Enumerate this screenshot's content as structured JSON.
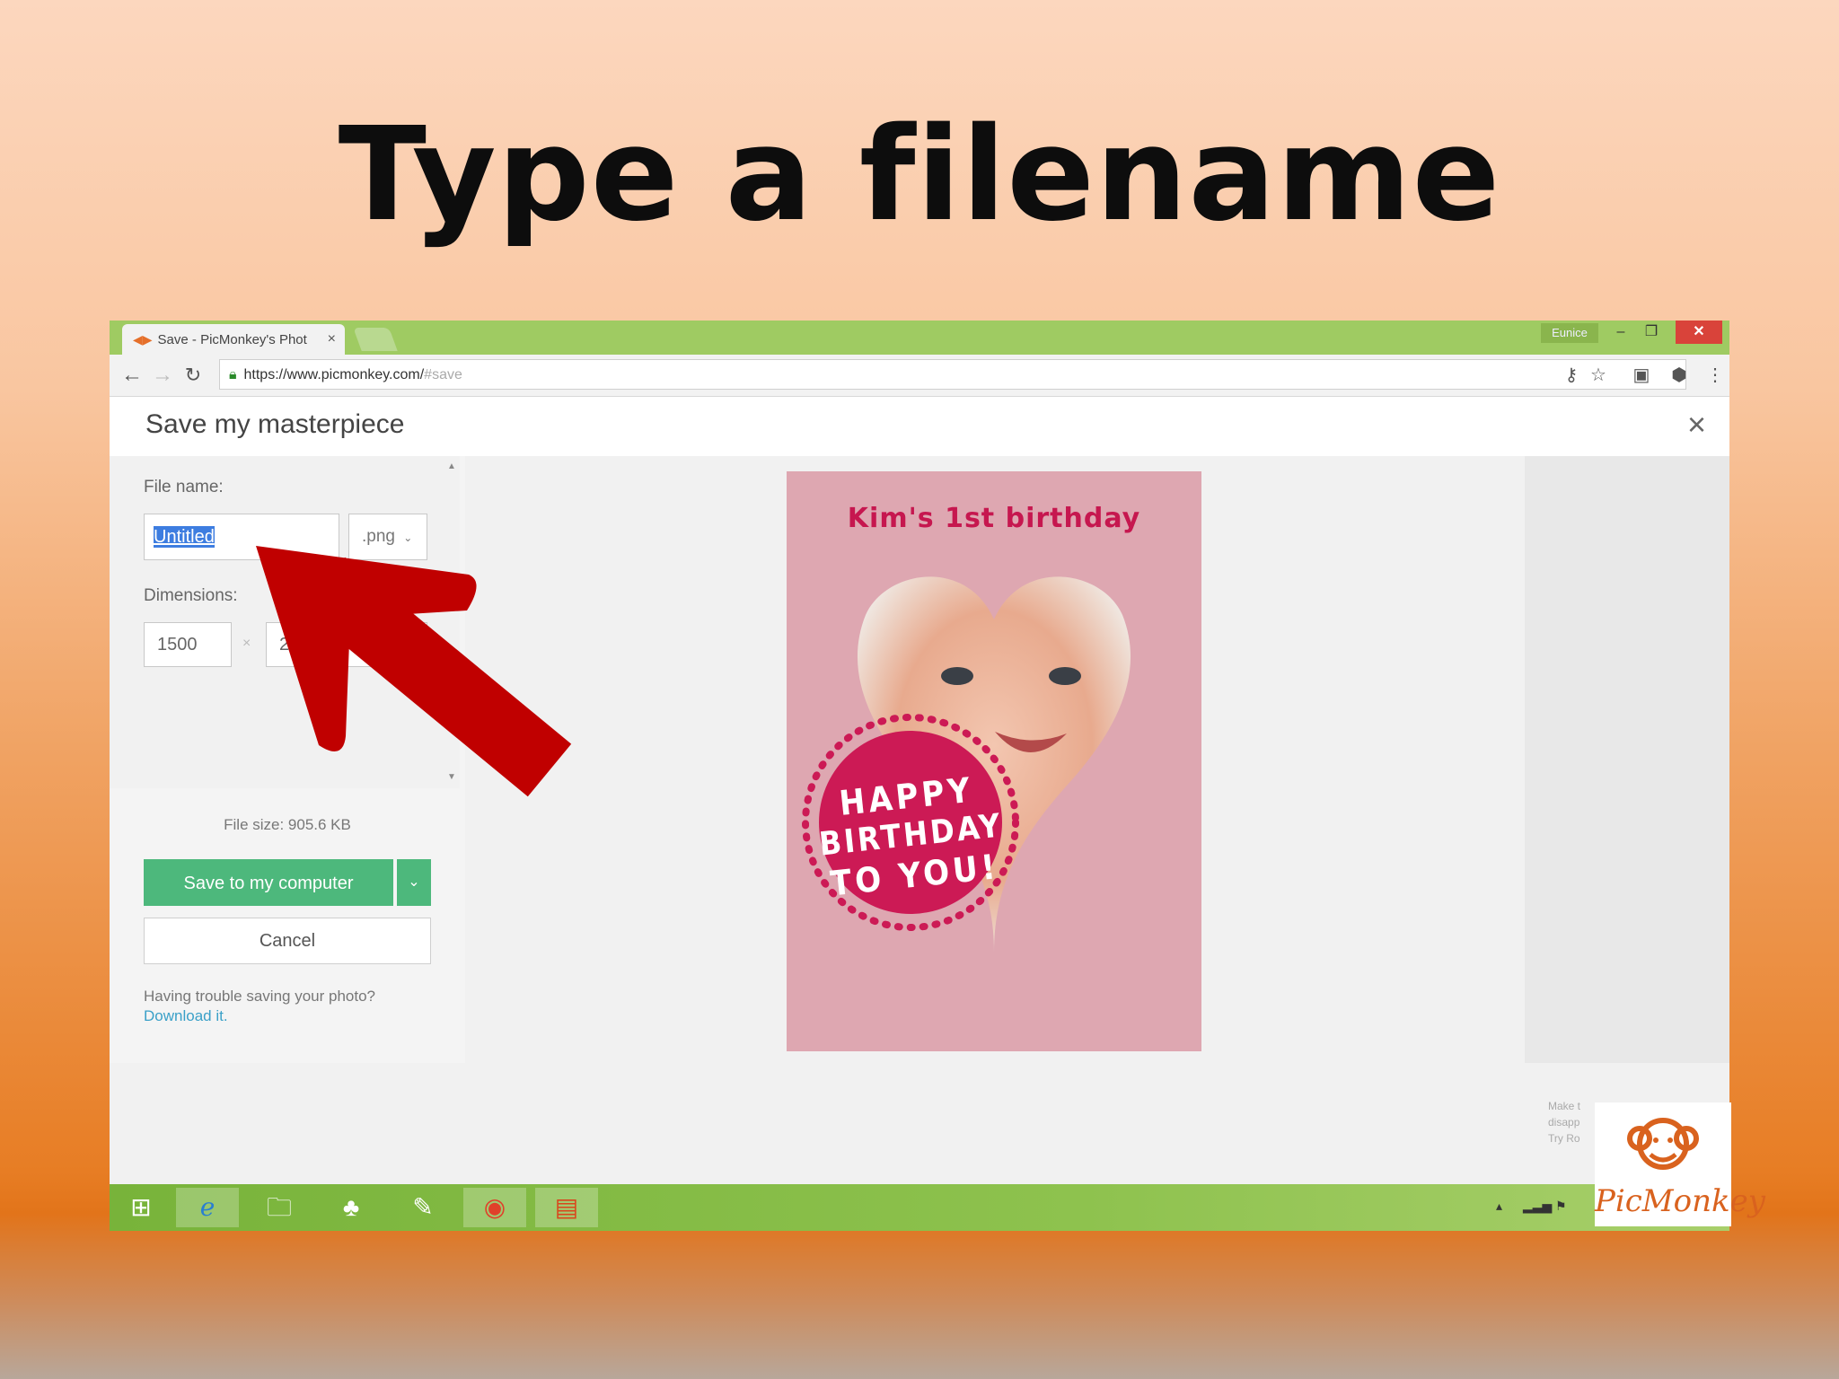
{
  "slide": {
    "title": "Type a filename"
  },
  "browser": {
    "tab_title": "Save - PicMonkey's Phot",
    "tab_close": "×",
    "profile_name": "Eunice",
    "win_min": "–",
    "win_max": "❐",
    "win_close": "✕",
    "url_main": "https://www.picmonkey.com/",
    "url_hash": "#save"
  },
  "dialog": {
    "title": "Save my masterpiece",
    "close": "×",
    "file_name_label": "File name:",
    "file_name_value": "Untitled",
    "file_type": ".png",
    "dimensions_label": "Dimensions:",
    "width_value": "1500",
    "dim_separator": "×",
    "height_value": "2",
    "file_size": "File size: 905.6 KB",
    "save_button": "Save to my computer",
    "cancel_button": "Cancel",
    "trouble_text": "Having trouble saving your photo?",
    "download_link": "Download it."
  },
  "preview": {
    "card_title": "Kim's 1st birthday",
    "badge_lines": [
      "HAPPY",
      "BIRTHDAY",
      "TO YOU!"
    ]
  },
  "side_note": [
    "Make t",
    "disapp",
    "Try Ro"
  ],
  "logo": {
    "text": "PicMonkey"
  },
  "colors": {
    "accent_green": "#4db87c",
    "chrome_green": "#9fcb62",
    "card_pink": "#dea7b1",
    "badge_red": "#cc1a55",
    "arrow_red": "#c00000"
  }
}
